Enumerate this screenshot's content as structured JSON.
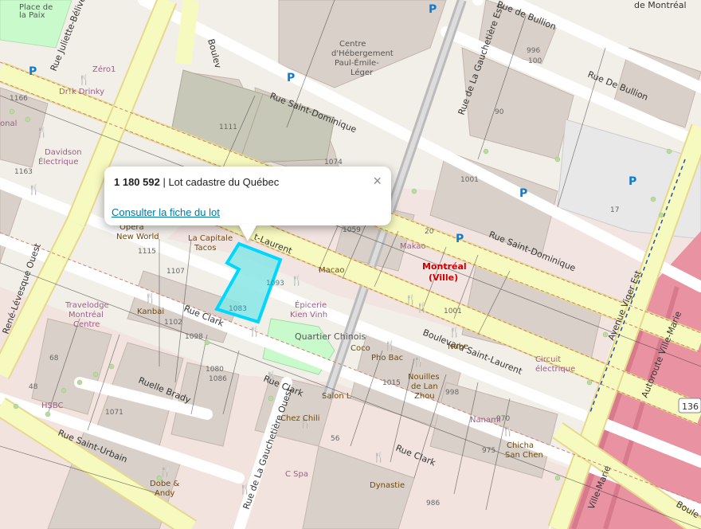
{
  "popup": {
    "lot_number": "1 180 592",
    "title_rest": " | Lot cadastre du Québec",
    "link_label": "Consulter la fiche du lot",
    "close_label": "×"
  },
  "map": {
    "streets": {
      "saint_laurent": "Boulevard Saint-Laurent",
      "saint_laurent_cut": "t-Laurent",
      "clark_1": "Rue Clark",
      "clark_2": "Rue Clark",
      "clark_3": "Rue Clark",
      "saint_dominique_1": "Rue Saint-Dominique",
      "saint_dominique_2": "Rue Saint-Dominique",
      "gauchetiere_est": "Rue de La Gauchetière Est",
      "gauchetiere_ouest": "Rue de La Gauchetière Ouest",
      "bullion_1": "Rue De Bullion",
      "bullion_2": "Rue de Bullion",
      "bullion_top": "Rue De Bullion",
      "saint_urbain": "Rue Saint-Urbain",
      "rene_levesque": "René-Lévesque Ouest",
      "juliette": "Rue Juliette-Béliveau",
      "boulevard_top": "Boulev",
      "ruelle_brady": "Ruelle Brady",
      "viger": "Avenue Viger Est",
      "autoroute": "Autoroute Ville-Marie",
      "ville_marie": "Ville-Marie",
      "route_shield": "136",
      "montreal_top": "de Montréal"
    },
    "places": {
      "city_name": "Montréal",
      "city_sub": "(Ville)",
      "centre": "Centre d'Hébergement Paul-Émile-Léger",
      "quartier": "Quartier Chinois",
      "place_paix": "Place de la Paix",
      "lot_label": "1083",
      "lot_label2": "1093"
    },
    "pois": {
      "zero1": "Zéro1",
      "drink": "Dr!k Drinky",
      "onal": "onal",
      "davidson": "Davidson",
      "electrique": "Électrique",
      "opera": "Opera",
      "new_world": "New World",
      "capitale": "La Capitale",
      "tacos": "Tacos",
      "macao": "Macao",
      "makao": "Makao",
      "epicerie": "Épicerie",
      "kien_vinh": "Kien Vinh",
      "coco": "Coco",
      "pho_bac": "Pho Bac",
      "nouilles": "Nouilles",
      "de_lan": "de Lan",
      "zhou": "Zhou",
      "travelodge": "Travelodge",
      "travelodge2": "Montréal",
      "travelodge3": "Centre",
      "kanbai": "Kanbai",
      "nabe": "Nabe",
      "nanami": "Nanami",
      "circuit": "Circuit",
      "electrique2": "électrique",
      "chez_chili": "Chez Chili",
      "salon": "Salon L",
      "chicha": "Chicha",
      "san_chen": "San Chen",
      "dobe": "Dobe &",
      "andy": "Andy",
      "dynastie": "Dynastie",
      "spa": "C Spa",
      "hsbc": "HSBC"
    },
    "numbers": [
      "1166",
      "1111",
      "1074",
      "1163",
      "1059",
      "1115",
      "1107",
      "1102",
      "1098",
      "1080",
      "1086",
      "1071",
      "1015",
      "998",
      "970",
      "975",
      "986",
      "1001",
      "1001",
      "996",
      "100",
      "90",
      "20",
      "17",
      "68",
      "48",
      "56",
      "1083"
    ],
    "colors": {
      "primary_road": "#f7fabf",
      "secondary_road": "#fcd6a4",
      "motorway": "#e892a2",
      "building": "#d9d0c9",
      "park": "#c8facc",
      "lot_fill": "#7fe6e6",
      "lot_stroke": "#00d7ff",
      "link": "#0078a8"
    }
  }
}
